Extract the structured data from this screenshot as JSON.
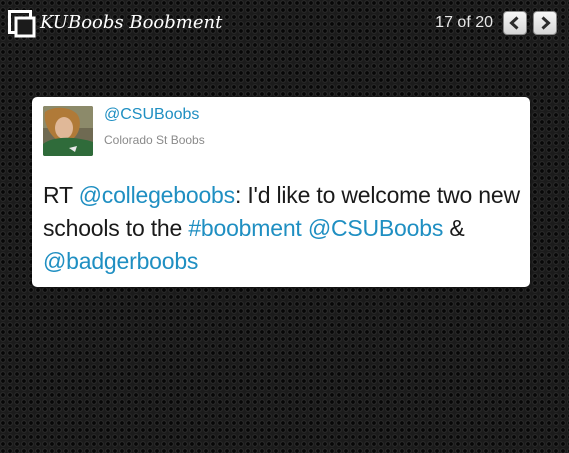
{
  "header": {
    "title": "KUBoobs Boobment",
    "counter": "17 of 20",
    "icon": "slideshow-frame-icon",
    "prev_icon": "chevron-left-icon",
    "next_icon": "chevron-right-icon"
  },
  "tweet": {
    "handle": "@CSUBoobs",
    "display_name": "Colorado St Boobs",
    "avatar_icon": "profile-photo",
    "segments": [
      {
        "text": "RT ",
        "type": "text"
      },
      {
        "text": "@collegeboobs",
        "type": "mention"
      },
      {
        "text": ": I'd like to welcome two new schools to the ",
        "type": "text"
      },
      {
        "text": "#boobment",
        "type": "hashtag"
      },
      {
        "text": " ",
        "type": "text"
      },
      {
        "text": "@CSUBoobs",
        "type": "mention"
      },
      {
        "text": " & ",
        "type": "text"
      },
      {
        "text": "@badgerboobs",
        "type": "mention"
      }
    ]
  },
  "colors": {
    "link": "#1f8fc2",
    "background": "#1b1b1b",
    "card": "#ffffff",
    "title_text": "#ffffff",
    "secondary_text": "#8a8a8a"
  }
}
